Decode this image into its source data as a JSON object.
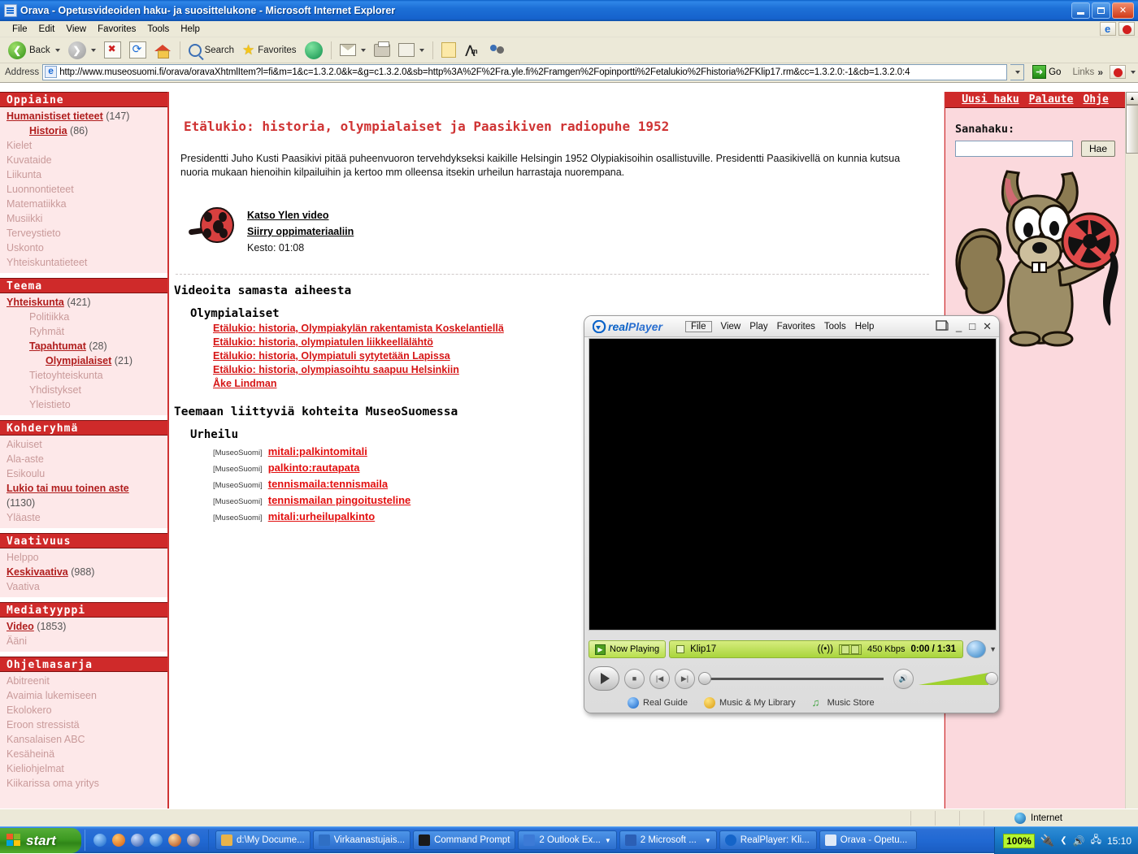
{
  "window": {
    "title": "Orava - Opetusvideoiden haku- ja suosittelukone - Microsoft Internet Explorer",
    "minimize_label": "Minimize",
    "maximize_label": "Restore",
    "close_label": "Close"
  },
  "menubar": {
    "items": [
      "File",
      "Edit",
      "View",
      "Favorites",
      "Tools",
      "Help"
    ]
  },
  "toolbar": {
    "back_label": "Back",
    "forward_label": "Forward",
    "stop_label": "Stop",
    "refresh_label": "Refresh",
    "home_label": "Home",
    "search_label": "Search",
    "favorites_label": "Favorites",
    "history_label": "History",
    "mail_label": "Mail",
    "print_label": "Print",
    "edit_label": "Edit",
    "notes_label": "Notes",
    "messenger_label": "Messenger",
    "discuss_label": "Discuss"
  },
  "address": {
    "label": "Address",
    "url": "http://www.museosuomi.fi/orava/oravaXhtmlItem?l=fi&m=1&c=1.3.2.0&k=&g=c1.3.2.0&sb=http%3A%2F%2Fra.yle.fi%2Framgen%2Fopinportti%2Fetalukio%2Fhistoria%2FKlip17.rm&cc=1.3.2.0:-1&cb=1.3.2.0:4",
    "go_label": "Go",
    "links_label": "Links"
  },
  "sidebar": {
    "sections": [
      {
        "header": "Oppiaine",
        "items": [
          {
            "label": "Humanistiset tieteet",
            "count": "(147)",
            "level": 1,
            "active": true
          },
          {
            "label": "Historia",
            "count": "(86)",
            "level": 2,
            "active": true
          },
          {
            "label": "Kielet",
            "count": "",
            "level": 1,
            "active": false
          },
          {
            "label": "Kuvataide",
            "count": "",
            "level": 1,
            "active": false
          },
          {
            "label": "Liikunta",
            "count": "",
            "level": 1,
            "active": false
          },
          {
            "label": "Luonnontieteet",
            "count": "",
            "level": 1,
            "active": false
          },
          {
            "label": "Matematiikka",
            "count": "",
            "level": 1,
            "active": false
          },
          {
            "label": "Musiikki",
            "count": "",
            "level": 1,
            "active": false
          },
          {
            "label": "Terveystieto",
            "count": "",
            "level": 1,
            "active": false
          },
          {
            "label": "Uskonto",
            "count": "",
            "level": 1,
            "active": false
          },
          {
            "label": "Yhteiskuntatieteet",
            "count": "",
            "level": 1,
            "active": false
          }
        ]
      },
      {
        "header": "Teema",
        "items": [
          {
            "label": "Yhteiskunta",
            "count": "(421)",
            "level": 1,
            "active": true
          },
          {
            "label": "Politiikka",
            "count": "",
            "level": 2,
            "active": false
          },
          {
            "label": "Ryhmät",
            "count": "",
            "level": 2,
            "active": false
          },
          {
            "label": "Tapahtumat",
            "count": "(28)",
            "level": 2,
            "active": true
          },
          {
            "label": "Olympialaiset",
            "count": "(21)",
            "level": 3,
            "active": true
          },
          {
            "label": "Tietoyhteiskunta",
            "count": "",
            "level": 2,
            "active": false
          },
          {
            "label": "Yhdistykset",
            "count": "",
            "level": 2,
            "active": false
          },
          {
            "label": "Yleistieto",
            "count": "",
            "level": 2,
            "active": false
          }
        ]
      },
      {
        "header": "Kohderyhmä",
        "items": [
          {
            "label": "Aikuiset",
            "count": "",
            "level": 1,
            "active": false
          },
          {
            "label": "Ala-aste",
            "count": "",
            "level": 1,
            "active": false
          },
          {
            "label": "Esikoulu",
            "count": "",
            "level": 1,
            "active": false
          },
          {
            "label": "Lukio tai muu toinen aste",
            "count": "(1130)",
            "level": 1,
            "active": true,
            "wrap": true
          },
          {
            "label": "Yläaste",
            "count": "",
            "level": 1,
            "active": false
          }
        ]
      },
      {
        "header": "Vaativuus",
        "items": [
          {
            "label": "Helppo",
            "count": "",
            "level": 1,
            "active": false
          },
          {
            "label": "Keskivaativa",
            "count": "(988)",
            "level": 1,
            "active": true
          },
          {
            "label": "Vaativa",
            "count": "",
            "level": 1,
            "active": false
          }
        ]
      },
      {
        "header": "Mediatyyppi",
        "items": [
          {
            "label": "Video",
            "count": "(1853)",
            "level": 1,
            "active": true
          },
          {
            "label": "Ääni",
            "count": "",
            "level": 1,
            "active": false
          }
        ]
      },
      {
        "header": "Ohjelmasarja",
        "items": [
          {
            "label": "Abitreenit",
            "count": "",
            "level": 1,
            "active": false
          },
          {
            "label": "Avaimia lukemiseen",
            "count": "",
            "level": 1,
            "active": false
          },
          {
            "label": "Ekolokero",
            "count": "",
            "level": 1,
            "active": false
          },
          {
            "label": "Eroon stressistä",
            "count": "",
            "level": 1,
            "active": false
          },
          {
            "label": "Kansalaisen ABC",
            "count": "",
            "level": 1,
            "active": false
          },
          {
            "label": "Kesäheinä",
            "count": "",
            "level": 1,
            "active": false
          },
          {
            "label": "Kieliohjelmat",
            "count": "",
            "level": 1,
            "active": false
          },
          {
            "label": "Kiikarissa oma yritys",
            "count": "",
            "level": 1,
            "active": false
          }
        ]
      }
    ]
  },
  "content": {
    "title": "Etälukio: historia, olympialaiset ja Paasikiven radiopuhe 1952",
    "paragraph": "Presidentti Juho Kusti Paasikivi pitää puheenvuoron tervehdykseksi kaikille Helsingin 1952 Olypiakisoihin osallistuville. Presidentti Paasikivellä on kunnia kutsua nuoria mukaan hienoihin kilpailuihin ja kertoo mm olleensa itsekin urheilun harrastaja nuorempana.",
    "video_link": "Katso Ylen video",
    "material_link": "Siirry oppimateriaaliin",
    "duration": "Kesto: 01:08",
    "related_videos_heading": "Videoita samasta aiheesta",
    "related_videos_subheading": "Olympialaiset",
    "related_videos": [
      "Etälukio: historia, Olympiakylän rakentamista Koskelantiellä",
      "Etälukio: historia, olympiatulen liikkeellälähtö",
      "Etälukio: historia, Olympiatuli sytytetään Lapissa",
      "Etälukio: historia, olympiasoihtu saapuu Helsinkiin",
      "Åke Lindman"
    ],
    "museum_heading": "Teemaan liittyviä kohteita MuseoSuomessa",
    "museum_subheading": "Urheilu",
    "museum_tag": "[MuseoSuomi]",
    "museum_items": [
      "mitali:palkintomitali",
      "palkinto:rautapata",
      "tennismaila:tennismaila",
      "tennismailan pingoitusteline",
      "mitali:urheilupalkinto"
    ]
  },
  "rightpanel": {
    "nav": [
      "Uusi haku",
      "Palaute",
      "Ohje"
    ],
    "search_label": "Sanahaku:",
    "search_value": "",
    "search_placeholder": "",
    "search_button": "Hae"
  },
  "realplayer": {
    "brand_c": "real",
    "brand_p": "Player",
    "menu": [
      "File",
      "View",
      "Play",
      "Favorites",
      "Tools",
      "Help"
    ],
    "now_playing": "Now Playing",
    "clip_title": "Klip17",
    "bitrate": "450 Kbps",
    "time": "0:00 / 1:31",
    "links": [
      "Real Guide",
      "Music & My Library",
      "Music Store"
    ],
    "minimize_label": "_",
    "maximize_label": "□",
    "close_label": "✕"
  },
  "statusbar": {
    "zone": "Internet"
  },
  "taskbar": {
    "start_label": "start",
    "tasks": [
      {
        "label": "d:\\My Docume...",
        "icon_color": "#e8b34a",
        "dropdown": false
      },
      {
        "label": "Virkaanastujais...",
        "icon_color": "#2f6fc4",
        "dropdown": false
      },
      {
        "label": "Command Prompt",
        "icon_color": "#1a1a1a",
        "dropdown": false
      },
      {
        "label": "2 Outlook Ex...",
        "icon_color": "#3c7ad6",
        "dropdown": true
      },
      {
        "label": "2 Microsoft ...",
        "icon_color": "#2b5fb5",
        "dropdown": true
      },
      {
        "label": "RealPlayer: Kli...",
        "icon_color": "#1464c8",
        "dropdown": false
      },
      {
        "label": "Orava - Opetu...",
        "icon_color": "#1a6bd6",
        "dropdown": false
      }
    ],
    "battery": "100%",
    "clock": "15:10"
  },
  "colors": {
    "brand_red": "#cf2a2a",
    "link_red": "#d61616",
    "panel_pink": "#fde8e9",
    "right_pink": "#fbd9dd",
    "title_blue": "#1c6fd6"
  }
}
